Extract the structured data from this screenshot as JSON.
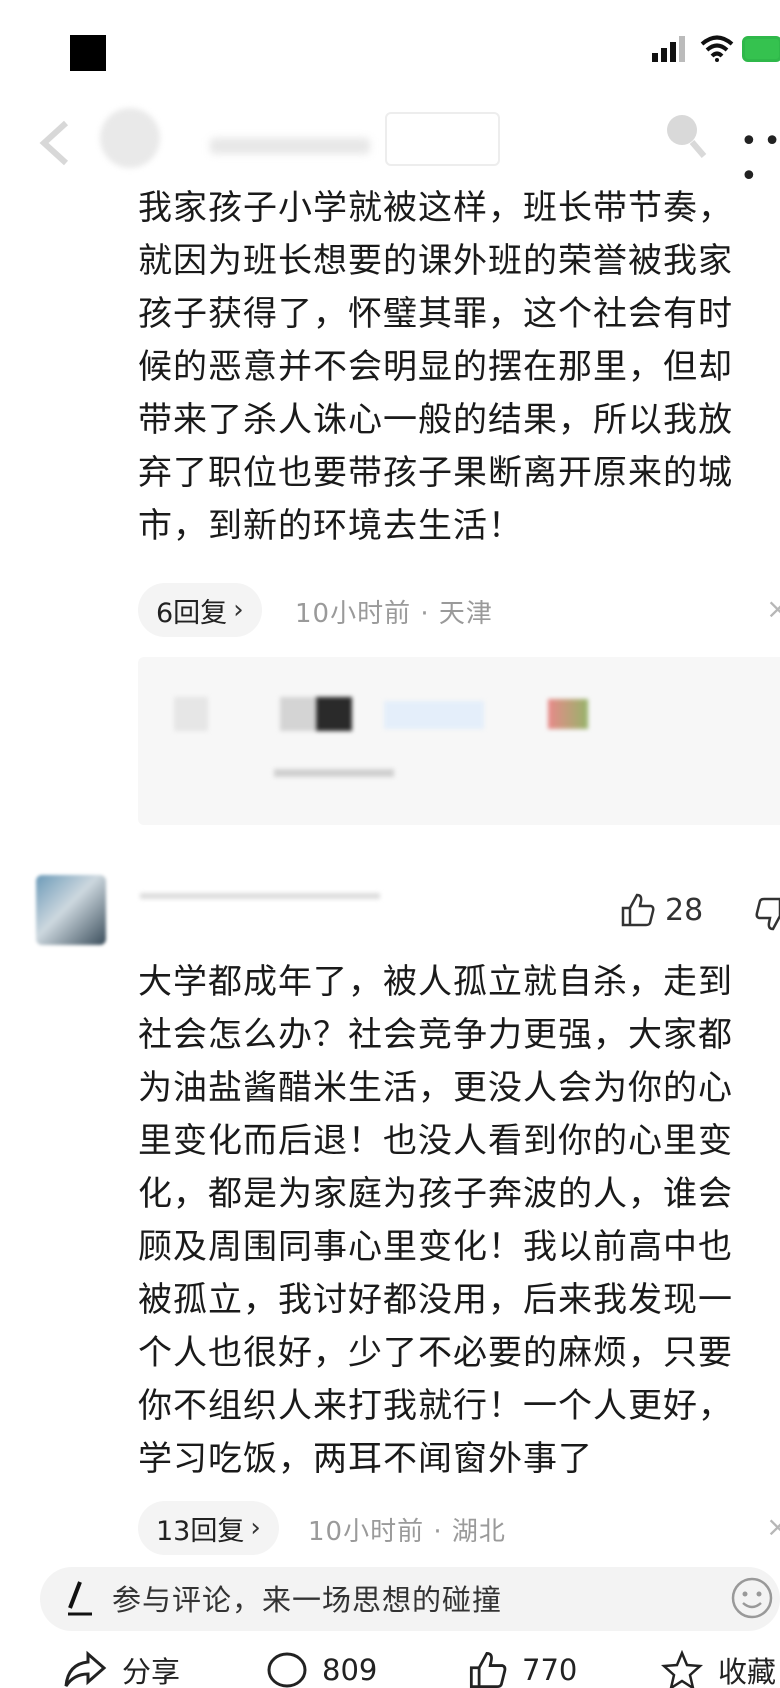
{
  "comment1": {
    "text": "我家孩子小学就被这样，班长带节奏，\n就因为班长想要的课外班的荣誉被我家\n孩子获得了，怀璧其罪，这个社会有时\n候的恶意并不会明显的摆在那里，但却\n带来了杀人诛心一般的结果，所以我放\n弃了职位也要带孩子果断离开原来的城\n市，到新的环境去生活！",
    "reply_label": "6回复",
    "meta": "10小时前 · 天津"
  },
  "comment2": {
    "likes": "28",
    "text": "大学都成年了，被人孤立就自杀，走到\n社会怎么办？社会竞争力更强，大家都\n为油盐酱醋米生活，更没人会为你的心\n里变化而后退！也没人看到你的心里变\n化，都是为家庭为孩子奔波的人，谁会\n顾及周围同事心里变化！我以前高中也\n被孤立，我讨好都没用，后来我发现一\n个人也很好，少了不必要的麻烦，只要\n你不组织人来打我就行！一个人更好，\n学习吃饭，两耳不闻窗外事了",
    "reply_label": "13回复",
    "meta": "10小时前 · 湖北"
  },
  "bottom": {
    "placeholder": "参与评论，来一场思想的碰撞",
    "share_label": "分享",
    "comment_count": "809",
    "like_count": "770",
    "favorite_label": "收藏"
  },
  "colors": {
    "battery": "#35c24f",
    "meta_gray": "#9a9a9a",
    "pill_bg": "#f4f4f4"
  }
}
